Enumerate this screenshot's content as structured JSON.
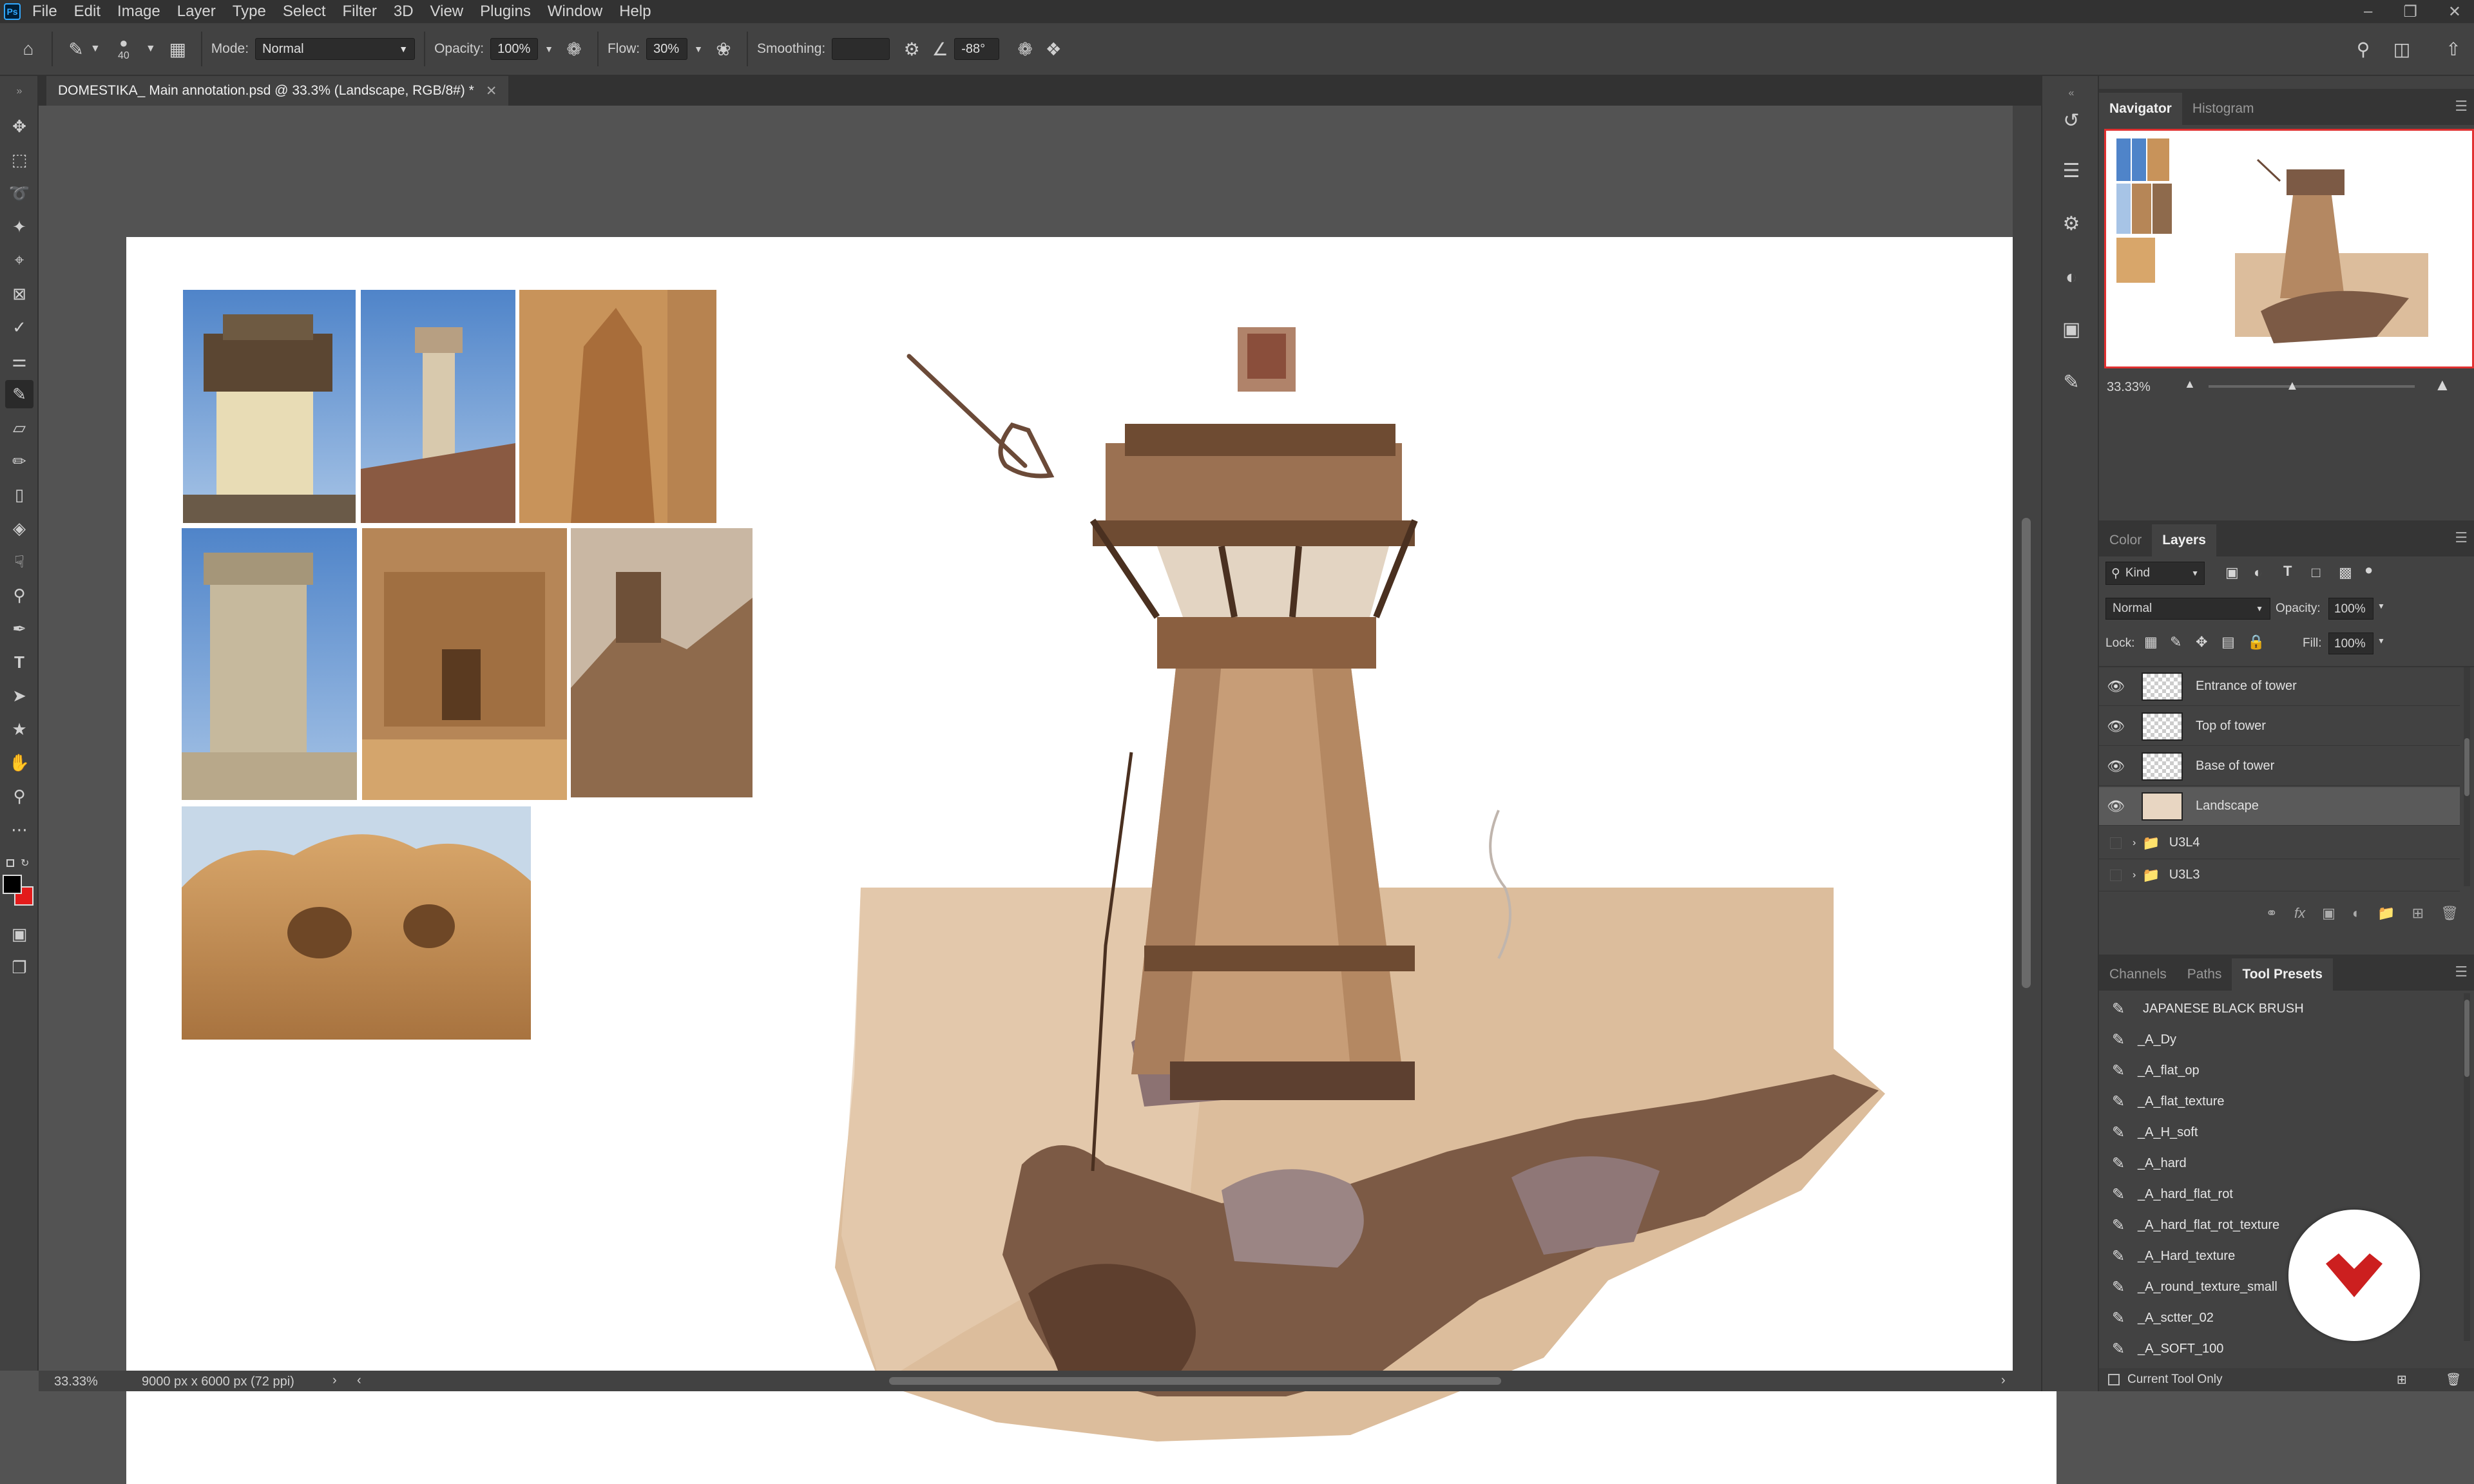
{
  "app": {
    "logo": "Ps"
  },
  "menu": [
    "File",
    "Edit",
    "Image",
    "Layer",
    "Type",
    "Select",
    "Filter",
    "3D",
    "View",
    "Plugins",
    "Window",
    "Help"
  ],
  "options": {
    "brush_size": "40",
    "mode_label": "Mode:",
    "mode_value": "Normal",
    "opacity_label": "Opacity:",
    "opacity_value": "100%",
    "flow_label": "Flow:",
    "flow_value": "30%",
    "smoothing_label": "Smoothing:",
    "smoothing_value": "",
    "angle_value": "-88°"
  },
  "document": {
    "tab_title": "DOMESTIKA_ Main annotation.psd @ 33.3% (Landscape, RGB/8#) *"
  },
  "status": {
    "zoom": "33.33%",
    "doc_size": "9000 px x 6000 px (72 ppi)"
  },
  "navigator": {
    "tabs": [
      "Navigator",
      "Histogram"
    ],
    "zoom": "33.33%"
  },
  "layers_panel": {
    "tabs": [
      "Color",
      "Layers"
    ],
    "filter_kind": "Kind",
    "blend_mode": "Normal",
    "opacity_label": "Opacity:",
    "opacity_value": "100%",
    "lock_label": "Lock:",
    "fill_label": "Fill:",
    "fill_value": "100%",
    "layers": [
      {
        "name": "Entrance of tower"
      },
      {
        "name": "Top of tower"
      },
      {
        "name": "Base of tower"
      },
      {
        "name": "Landscape"
      }
    ],
    "groups": [
      {
        "name": "U3L4"
      },
      {
        "name": "U3L3"
      }
    ]
  },
  "presets_panel": {
    "tabs": [
      "Channels",
      "Paths",
      "Tool Presets"
    ],
    "items": [
      "JAPANESE BLACK BRUSH",
      "_A_Dy",
      "_A_flat_op",
      "_A_flat_texture",
      "_A_H_soft",
      "_A_hard",
      "_A_hard_flat_rot",
      "_A_hard_flat_rot_texture",
      "_A_Hard_texture",
      "_A_round_texture_small",
      "_A_sctter_02",
      "_A_SOFT_100"
    ],
    "current_tool_only": "Current Tool Only"
  },
  "colors": {
    "foreground": "#000000",
    "background": "#e31b1b",
    "accent_domestika": "#cc1f1f"
  }
}
